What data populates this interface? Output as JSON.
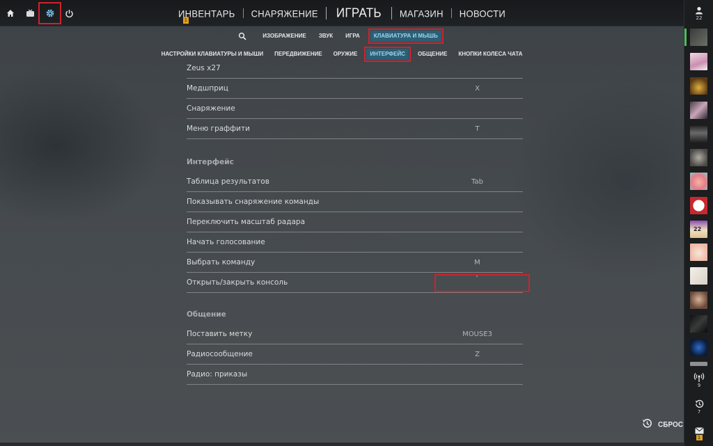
{
  "topbar": {
    "icons": [
      "home-icon",
      "tv-icon",
      "gear-icon",
      "power-icon"
    ],
    "nav": {
      "inventory": "ИНВЕНТАРЬ",
      "inventory_badge": "1",
      "loadout": "СНАРЯЖЕНИЕ",
      "play": "ИГРАТЬ",
      "store": "МАГАЗИН",
      "news": "НОВОСТИ"
    }
  },
  "settings_tabs": {
    "items": [
      "ИЗОБРАЖЕНИЕ",
      "ЗВУК",
      "ИГРА",
      "КЛАВИАТУРА И МЫШЬ"
    ],
    "active": "КЛАВИАТУРА И МЫШЬ"
  },
  "keyboard_tabs": {
    "items": [
      "НАСТРОЙКИ КЛАВИАТУРЫ И МЫШИ",
      "ПЕРЕДВИЖЕНИЕ",
      "ОРУЖИЕ",
      "ИНТЕРФЕЙС",
      "ОБЩЕНИЕ",
      "КНОПКИ КОЛЕСА ЧАТА"
    ],
    "active": "ИНТЕРФЕЙС"
  },
  "bindings": {
    "top_rows": [
      {
        "label": "Zeus x27",
        "key": ""
      },
      {
        "label": "Медшприц",
        "key": "X"
      },
      {
        "label": "Снаряжение",
        "key": ""
      },
      {
        "label": "Меню граффити",
        "key": "T"
      }
    ],
    "interface_title": "Интерфейс",
    "interface_rows": [
      {
        "label": "Таблица результатов",
        "key": "Tab"
      },
      {
        "label": "Показывать снаряжение команды",
        "key": ""
      },
      {
        "label": "Переключить масштаб радара",
        "key": ""
      },
      {
        "label": "Начать голосование",
        "key": ""
      },
      {
        "label": "Выбрать команду",
        "key": "M"
      },
      {
        "label": "Открыть/закрыть консоль",
        "key": "`"
      }
    ],
    "comm_title": "Общение",
    "comm_rows": [
      {
        "label": "Поставить метку",
        "key": "MOUSE3"
      },
      {
        "label": "Радиосообщение",
        "key": "Z"
      },
      {
        "label": "Радио: приказы",
        "key": ""
      }
    ]
  },
  "reset": {
    "label": "СБРОС"
  },
  "sidebar": {
    "friends_count": "22",
    "friend_badge_number": "22",
    "antenna_count": "9",
    "history_count": "7",
    "mail_badge": "1"
  },
  "colors": {
    "highlight_red": "#d0222c",
    "active_tab_bg": "#2c5e74",
    "badge_orange": "#e3a01f",
    "online_green": "#4bbf5a"
  }
}
